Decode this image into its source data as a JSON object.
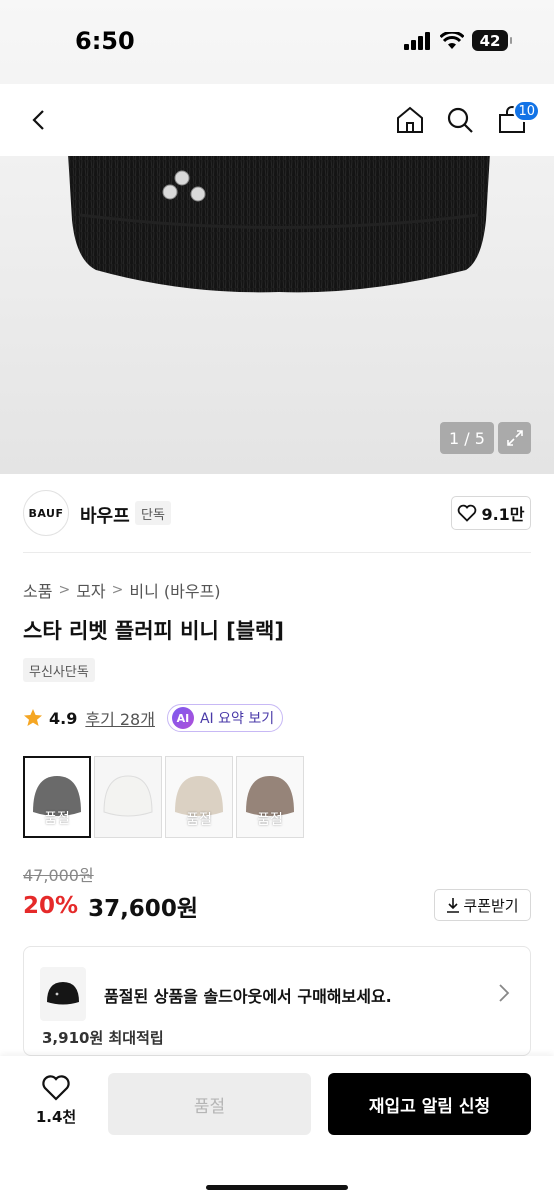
{
  "status": {
    "time": "6:50",
    "battery": "42"
  },
  "nav": {
    "cart_count": "10"
  },
  "gallery": {
    "counter": "1 / 5"
  },
  "brand": {
    "logo_text": "BAUF",
    "name": "바우프",
    "tag": "단독",
    "likes": "9.1만"
  },
  "breadcrumb": [
    "소품",
    "모자",
    "비니 (바우프)"
  ],
  "product": {
    "title": "스타 리벳 플러피 비니 [블랙]",
    "exclusive": "무신사단독"
  },
  "rating": {
    "score": "4.9",
    "reviews": "후기 28개",
    "ai_badge": "AI",
    "ai_label": "AI 요약 보기"
  },
  "swatches": [
    {
      "color": "#1b1b1b",
      "label": "품절"
    },
    {
      "color": "#f3f3f1",
      "label": ""
    },
    {
      "color": "#c8b9a4",
      "label": "품절"
    },
    {
      "color": "#5e4332",
      "label": "품절"
    }
  ],
  "price": {
    "original": "47,000원",
    "discount": "20%",
    "final": "37,600원",
    "coupon": "쿠폰받기"
  },
  "banner": {
    "text": "품절된 상품을 솔드아웃에서 구매해보세요.",
    "peek": "3,910원 최대적립"
  },
  "bottom": {
    "wish_count": "1.4천",
    "soldout": "품절",
    "restock": "재입고 알림 신청"
  }
}
